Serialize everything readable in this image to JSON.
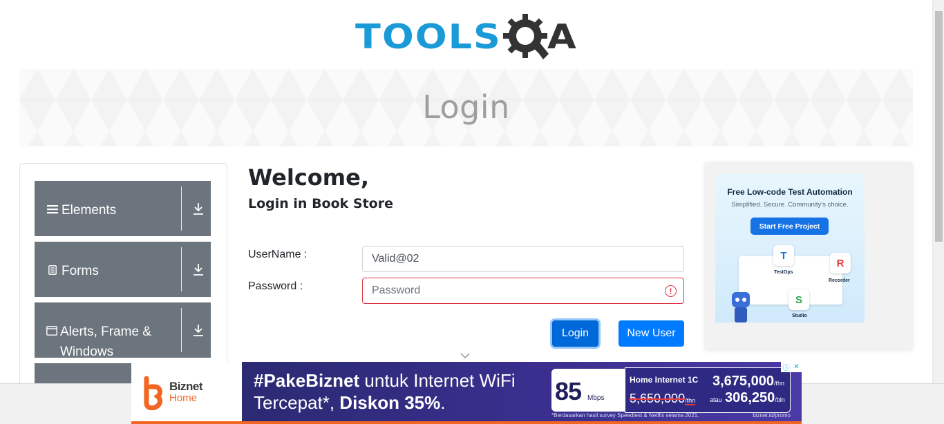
{
  "page": {
    "banner_title": "Login"
  },
  "logo": {
    "text": "TOOLS",
    "suffix": "A"
  },
  "sidebar": {
    "groups": [
      {
        "label": "Elements",
        "icon": "hamburger-icon"
      },
      {
        "label": "Forms",
        "icon": "document-icon"
      },
      {
        "label": "Alerts, Frame & Windows",
        "icon": "window-icon"
      }
    ]
  },
  "main": {
    "heading": "Welcome,",
    "subheading": "Login in Book Store",
    "username_label": "UserName :",
    "username_value": "Valid@02",
    "password_label": "Password :",
    "password_placeholder": "Password",
    "login_button": "Login",
    "new_user_button": "New User"
  },
  "side_ad": {
    "title": "Free Low-code Test Automation",
    "subtitle": "Simplified. Secure. Community's choice.",
    "button": "Start Free Project",
    "tags": [
      "TestOps",
      "Recorder",
      "Studio"
    ]
  },
  "bottom_ad": {
    "brand": "Biznet",
    "brand_sub": "Home",
    "headline_bold": "#PakeBiznet",
    "headline_rest": " untuk Internet WiFi",
    "line2_start": "Tercepat*, ",
    "line2_bold": "Diskon 35%",
    "line2_end": ".",
    "speed": "85",
    "speed_unit": "Mbps",
    "plan": "Home Internet 1C",
    "price_year": "3,675,000",
    "price_year_unit": "/thn",
    "price_old": "5,650,000",
    "price_old_unit": "/thn",
    "or": "atau",
    "price_month": "306,250",
    "price_month_unit": "/bln",
    "footnote": "*Berdasarkan hasil survey Speedtest & Netflix selama 2021.",
    "url": "biznet.id/promo"
  },
  "colors": {
    "primary": "#007bff",
    "sidebar_group": "#6c757d",
    "invalid": "#dc3545",
    "logo_blue": "#1a9ad6",
    "logo_dark": "#333333"
  }
}
